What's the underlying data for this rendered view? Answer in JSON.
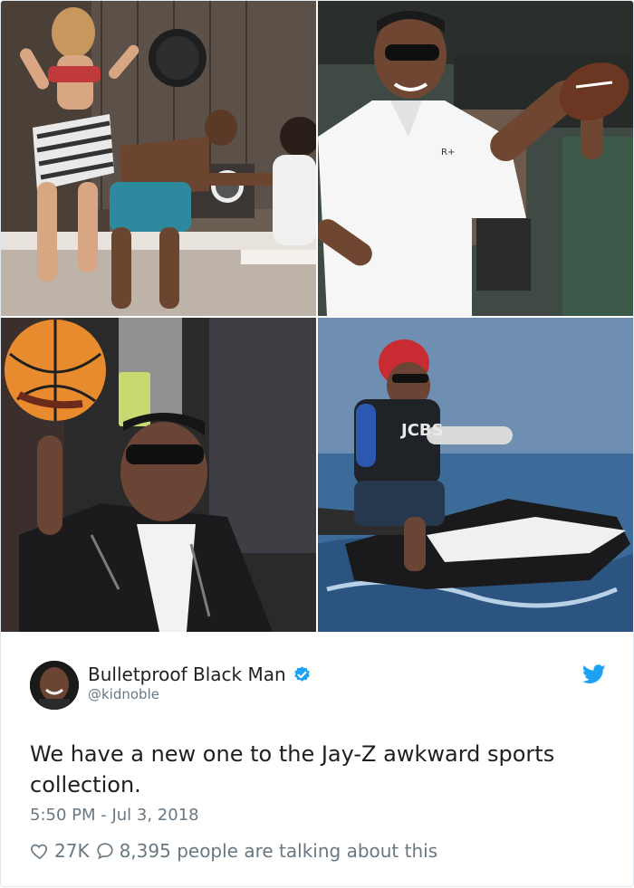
{
  "tweet": {
    "display_name": "Bulletproof Black Man",
    "handle": "@kidnoble",
    "text": "We have a new one to the Jay-Z awkward sports collection.",
    "timestamp": "5:50 PM - Jul 3, 2018",
    "likes": "27K",
    "replies_text": "8,395 people are talking about this"
  },
  "photos": {
    "jersey_text": "R+",
    "vest_text": "JCBS"
  },
  "icons": {
    "verified": "verified-badge-icon",
    "twitter": "twitter-bird-icon",
    "like": "heart-icon",
    "reply": "speech-bubble-icon"
  },
  "colors": {
    "twitter_blue": "#1da1f2",
    "text": "#1c2022",
    "secondary": "#697882"
  }
}
